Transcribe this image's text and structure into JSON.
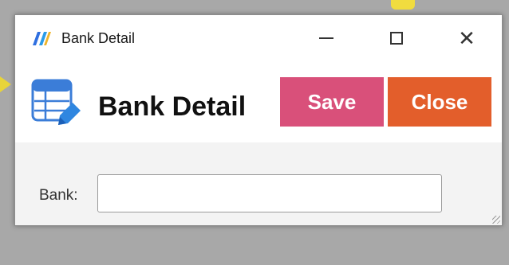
{
  "window": {
    "title": "Bank Detail",
    "controls": {
      "minimize_icon": "minimize-icon",
      "maximize_icon": "maximize-icon",
      "close_icon": "close-icon"
    }
  },
  "header": {
    "title": "Bank Detail",
    "save_label": "Save",
    "close_label": "Close"
  },
  "form": {
    "bank_label": "Bank:",
    "bank_value": ""
  },
  "colors": {
    "save": "#d9507a",
    "close": "#e35e2b"
  }
}
